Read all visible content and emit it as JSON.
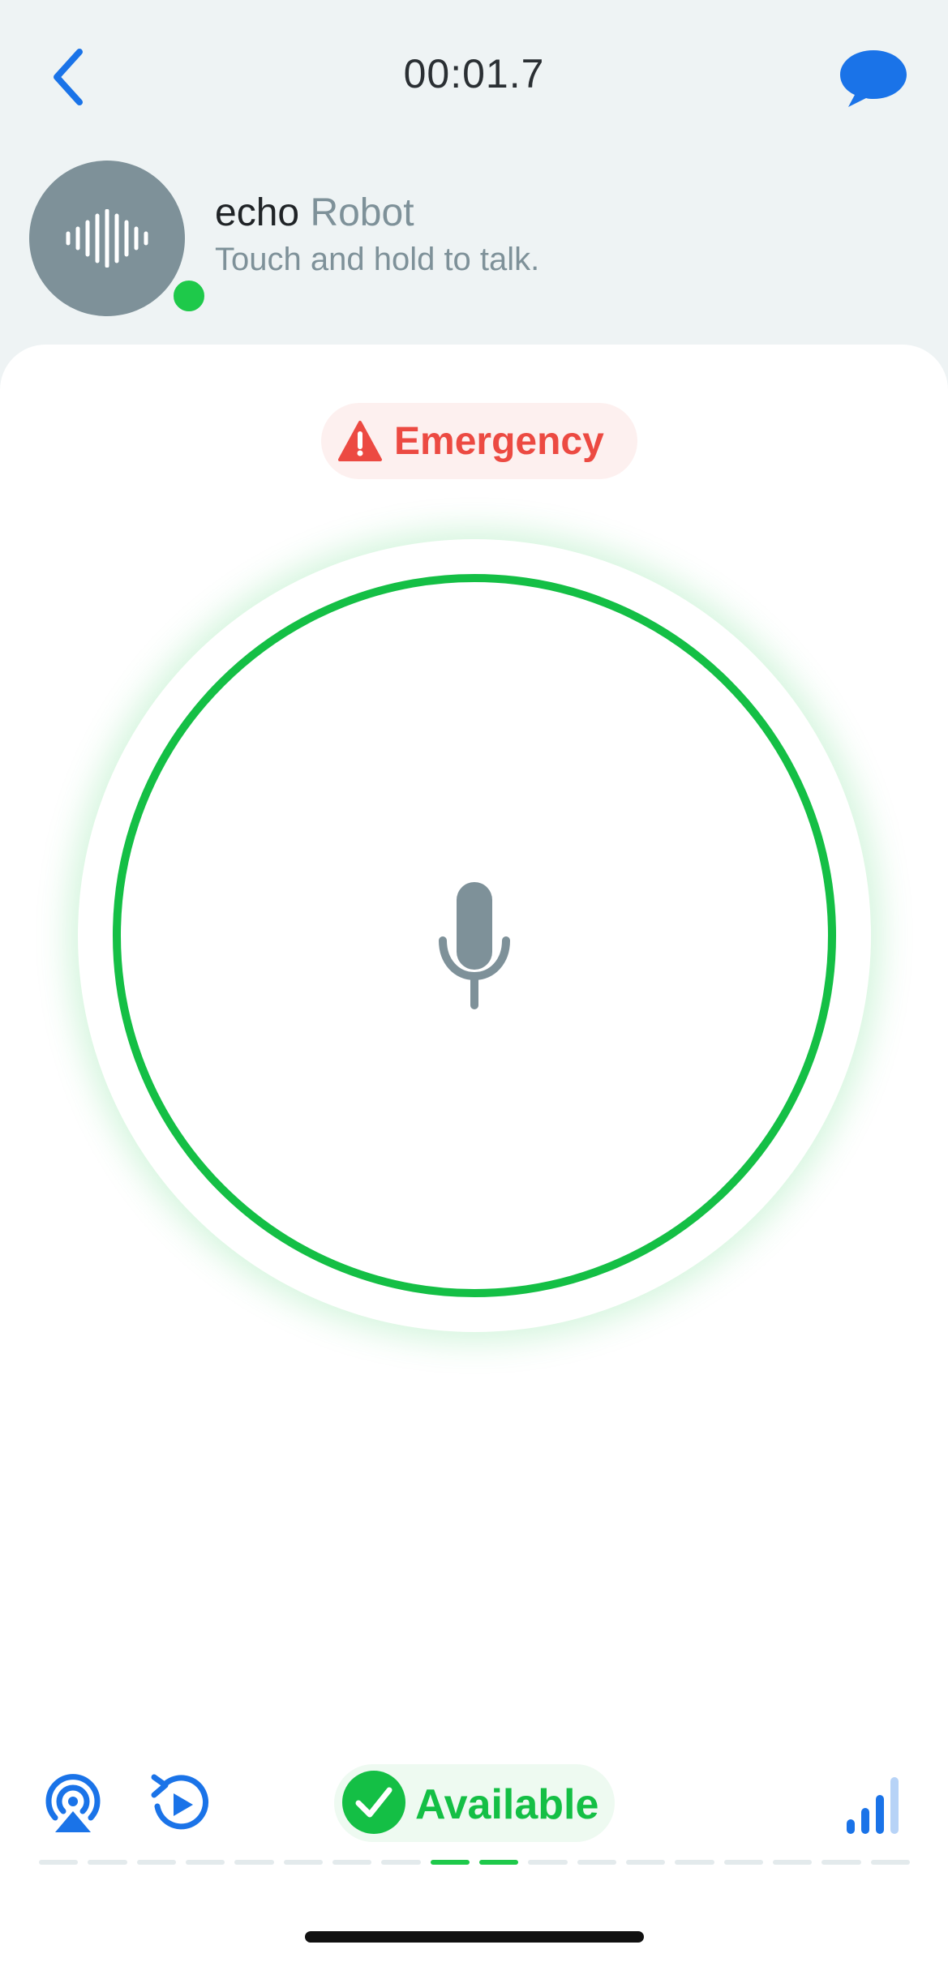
{
  "header": {
    "timer": "00:01.7",
    "back_icon": "chevron-left-icon",
    "chat_icon": "chat-bubble-icon"
  },
  "contact": {
    "name": "echo",
    "type_label": "Robot",
    "subtitle": "Touch and hold to talk.",
    "avatar_icon": "waveform-icon",
    "status": "online"
  },
  "emergency": {
    "label": "Emergency",
    "icon": "warning-triangle-icon"
  },
  "talk_button": {
    "icon": "microphone-icon"
  },
  "bottom_bar": {
    "airplay_icon": "airplay-icon",
    "replay_icon": "replay-icon",
    "status_label": "Available",
    "status_icon": "check-circle-icon",
    "signal_icon": "signal-strength-icon"
  },
  "level_meter": {
    "segments": 18,
    "active_segments": [
      8,
      9
    ]
  },
  "colors": {
    "accent_blue": "#1a73e8",
    "available_green": "#14bf45",
    "emergency_red": "#ec4a42",
    "muted_gray": "#7e9199"
  }
}
